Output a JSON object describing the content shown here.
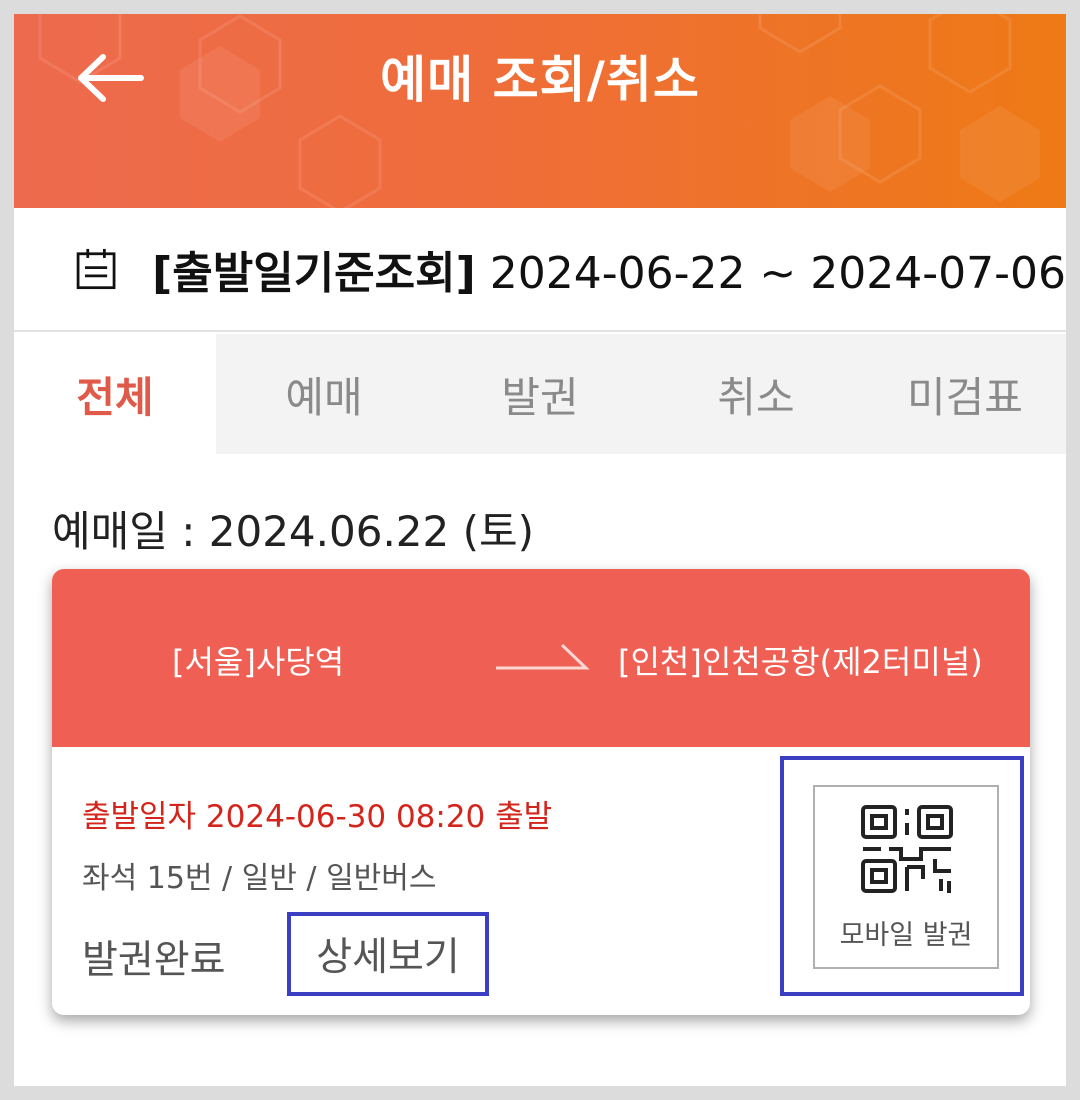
{
  "header": {
    "title": "예매 조회/취소",
    "back_icon": "back-arrow-icon"
  },
  "date_range": {
    "icon": "calendar-icon",
    "label": "[출발일기준조회]",
    "range": "2024-06-22 ~ 2024-07-06"
  },
  "tabs": [
    {
      "label": "전체",
      "active": true
    },
    {
      "label": "예매",
      "active": false
    },
    {
      "label": "발권",
      "active": false
    },
    {
      "label": "취소",
      "active": false
    },
    {
      "label": "미검표",
      "active": false
    }
  ],
  "booking": {
    "date_line": "예매일 : 2024.06.22 (토)",
    "route_from": "[서울]사당역",
    "route_to": "[인천]인천공항(제2터미널)",
    "departure": "출발일자 2024-06-30 08:20 출발",
    "seat_info": "좌석 15번 / 일반 / 일반버스",
    "status": "발권완료",
    "detail_button": "상세보기",
    "mobile_ticket_label": "모바일 발권",
    "mobile_ticket_icon": "qr-code-icon"
  },
  "colors": {
    "header_start": "#ee6a4f",
    "header_end": "#ee7a14",
    "route_bg": "#ef5f53",
    "active_tab": "#e05a4a",
    "departure_text": "#d4251c",
    "highlight_border": "#3b3fc4"
  }
}
